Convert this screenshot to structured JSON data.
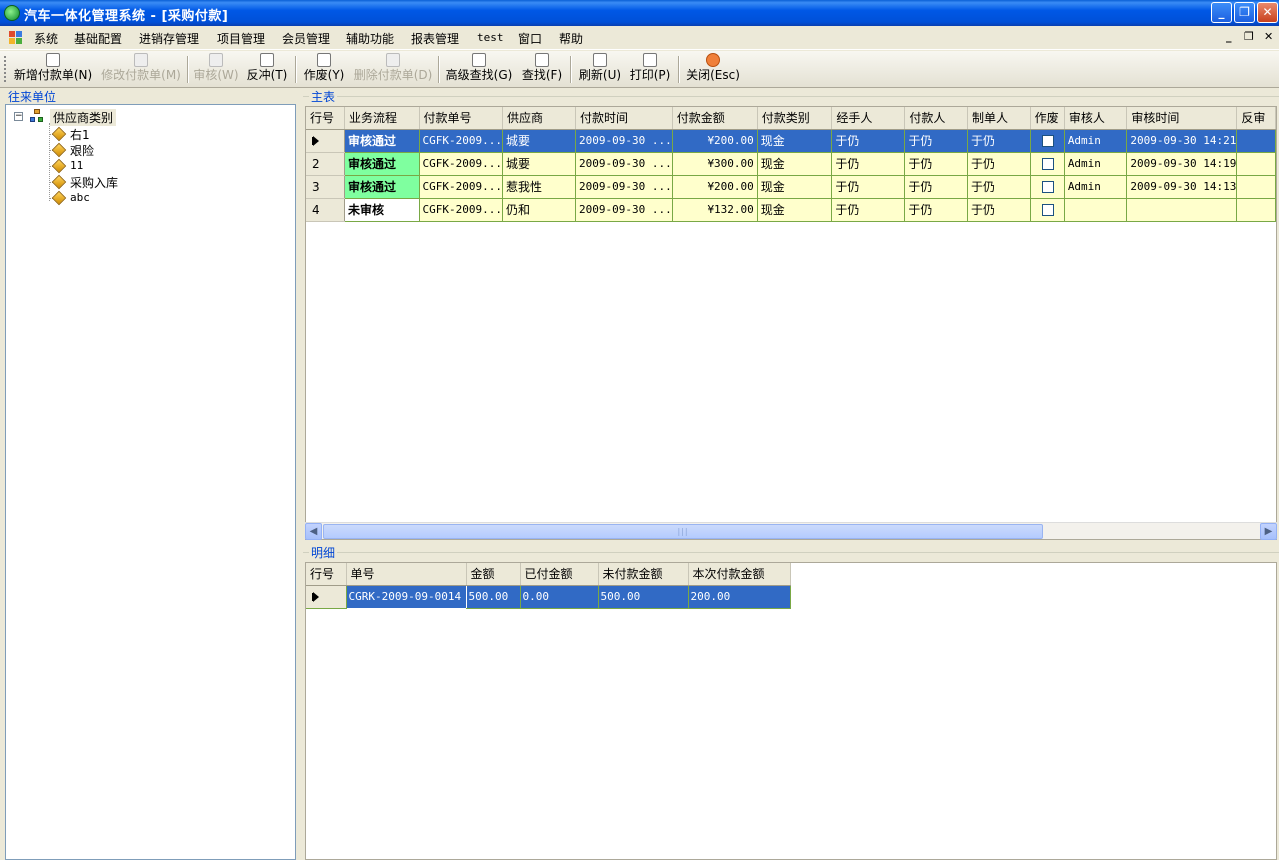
{
  "window": {
    "title": "汽车一体化管理系统 - [采购付款]",
    "controls": {
      "minimize": "_",
      "restore": "❐",
      "close": "✕"
    }
  },
  "menu": {
    "items": [
      "系统",
      "基础配置",
      "进销存管理",
      "项目管理",
      "会员管理",
      "辅助功能",
      "报表管理",
      "test",
      "窗口",
      "帮助"
    ],
    "mdi_controls": {
      "minimize": "_",
      "restore": "❐",
      "close": "✕"
    }
  },
  "toolbar": {
    "items": [
      {
        "label": "新增付款单(N)",
        "icon": "new-doc-icon",
        "enabled": true
      },
      {
        "label": "修改付款单(M)",
        "icon": "edit-doc-icon",
        "enabled": false
      },
      {
        "label": "审核(W)",
        "icon": "approve-icon",
        "enabled": false
      },
      {
        "label": "反冲(T)",
        "icon": "undo-icon",
        "enabled": true
      },
      {
        "label": "作废(Y)",
        "icon": "scissors-icon",
        "enabled": true
      },
      {
        "label": "删除付款单(D)",
        "icon": "delete-icon",
        "enabled": false
      },
      {
        "label": "高级查找(G)",
        "icon": "binoculars-icon",
        "enabled": true
      },
      {
        "label": "查找(F)",
        "icon": "magnifier-icon",
        "enabled": true
      },
      {
        "label": "刷新(U)",
        "icon": "refresh-icon",
        "enabled": true
      },
      {
        "label": "打印(P)",
        "icon": "printer-icon",
        "enabled": true
      },
      {
        "label": "关闭(Esc)",
        "icon": "close-icon",
        "enabled": true
      }
    ]
  },
  "left_panel": {
    "title": "往来单位",
    "tree": {
      "root": "供应商类别",
      "children": [
        "右1",
        "艰险",
        "11",
        "采购入库",
        "abc"
      ]
    }
  },
  "main_table": {
    "title": "主表",
    "columns": [
      "行号",
      "业务流程",
      "付款单号",
      "供应商",
      "付款时间",
      "付款金额",
      "付款类别",
      "经手人",
      "付款人",
      "制单人",
      "作废",
      "审核人",
      "审核时间",
      "反审"
    ],
    "rows": [
      {
        "row": "",
        "flow": "审核通过",
        "no": "CGFK-2009...",
        "supplier": "城要",
        "time": "2009-09-30 ...",
        "amount": "¥200.00",
        "category": "现金",
        "handler": "于仍",
        "payer": "于仍",
        "maker": "于仍",
        "void": false,
        "auditor": "Admin",
        "audit_time": "2009-09-30 14:21",
        "selected": true
      },
      {
        "row": "2",
        "flow": "审核通过",
        "no": "CGFK-2009...",
        "supplier": "城要",
        "time": "2009-09-30 ...",
        "amount": "¥300.00",
        "category": "现金",
        "handler": "于仍",
        "payer": "于仍",
        "maker": "于仍",
        "void": false,
        "auditor": "Admin",
        "audit_time": "2009-09-30 14:19",
        "selected": false
      },
      {
        "row": "3",
        "flow": "审核通过",
        "no": "CGFK-2009...",
        "supplier": "惹我性",
        "time": "2009-09-30 ...",
        "amount": "¥200.00",
        "category": "现金",
        "handler": "于仍",
        "payer": "于仍",
        "maker": "于仍",
        "void": false,
        "auditor": "Admin",
        "audit_time": "2009-09-30 14:13",
        "selected": false
      },
      {
        "row": "4",
        "flow": "未审核",
        "no": "CGFK-2009...",
        "supplier": "仍和",
        "time": "2009-09-30 ...",
        "amount": "¥132.00",
        "category": "现金",
        "handler": "于仍",
        "payer": "于仍",
        "maker": "于仍",
        "void": false,
        "auditor": "",
        "audit_time": "",
        "selected": false
      }
    ]
  },
  "detail_table": {
    "title": "明细",
    "columns": [
      "行号",
      "单号",
      "金额",
      "已付金额",
      "未付款金额",
      "本次付款金额"
    ],
    "rows": [
      {
        "row": "",
        "no": "CGRK-2009-09-0014",
        "amount": "500.00",
        "paid": "0.00",
        "unpaid": "500.00",
        "this_pay": "200.00"
      }
    ]
  },
  "colors": {
    "title_bar": "#0058e6",
    "selected_row": "#316ac5",
    "row_bg": "#ffffcc",
    "status_ok": "#7fff9f",
    "group_label": "#0046d5"
  }
}
